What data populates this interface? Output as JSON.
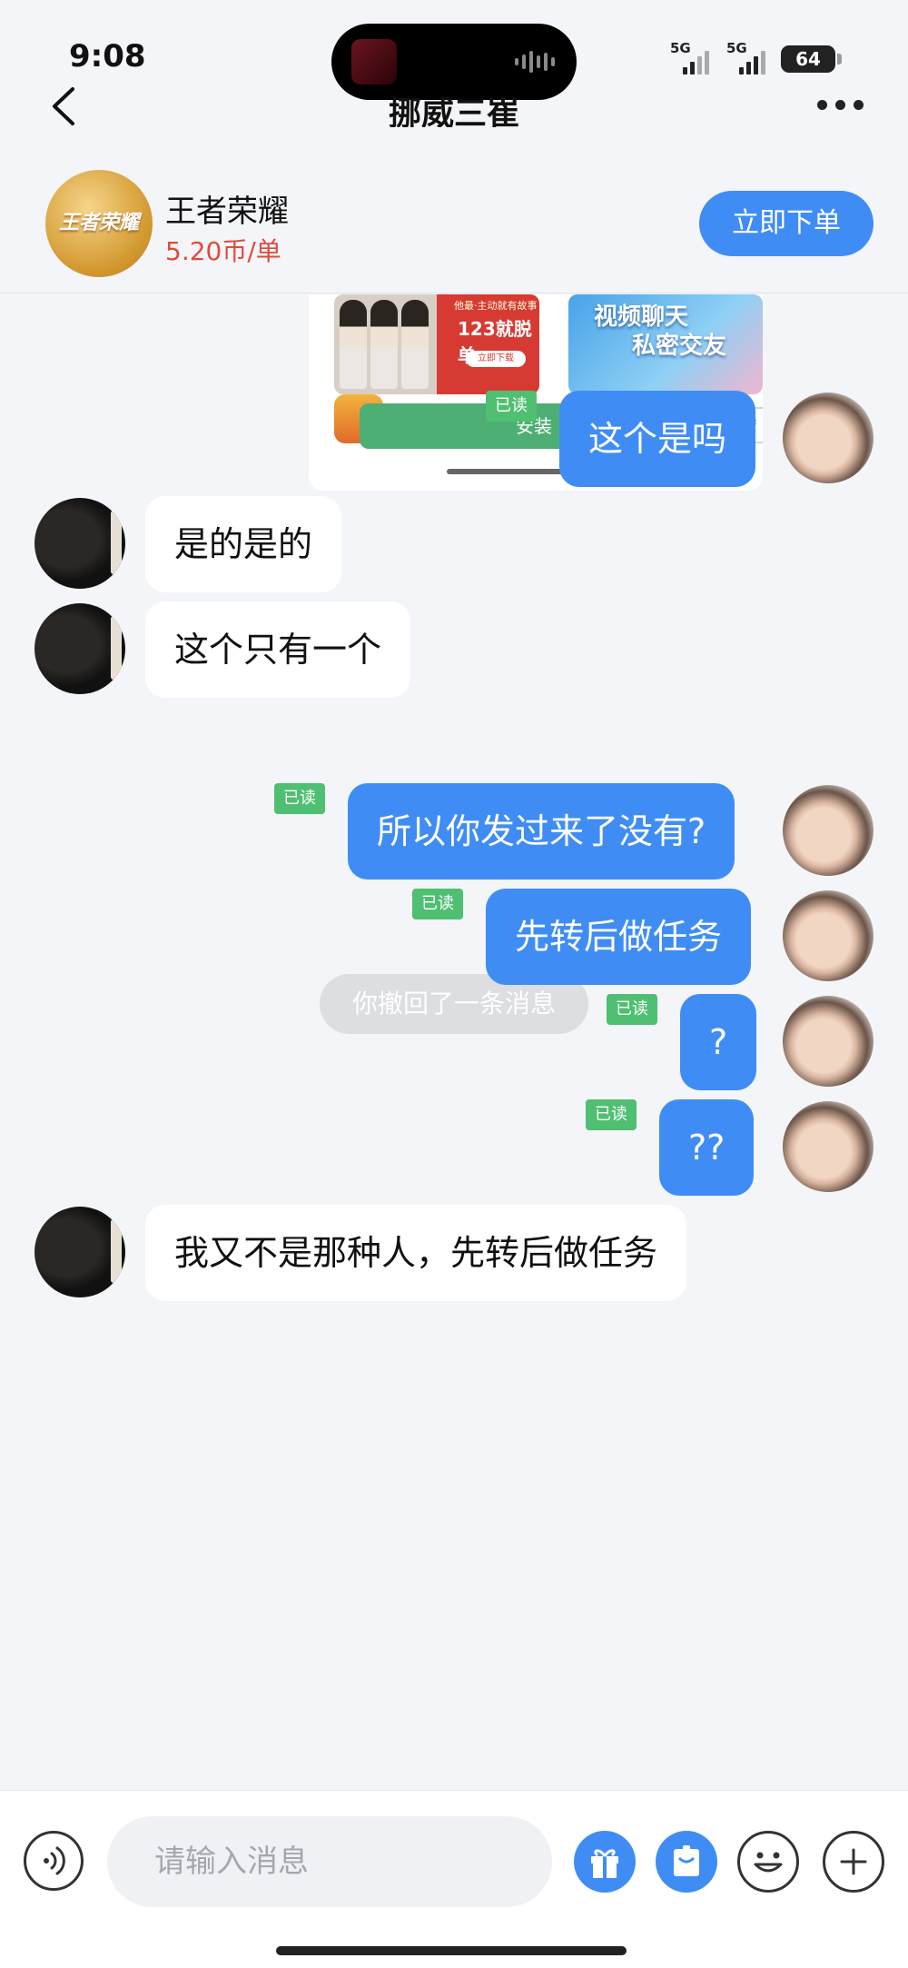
{
  "status": {
    "time": "9:08",
    "network_1": "5G",
    "network_2": "5G",
    "battery": "64"
  },
  "nav": {
    "title": "挪威三崔"
  },
  "service": {
    "name": "王者荣耀",
    "price": "5.20币/单",
    "order_button": "立即下单",
    "logo_text": "王者荣耀"
  },
  "ad": {
    "image1_caption": "他最·主动就有故事",
    "image1_title": "123就脱单",
    "image1_button": "立即下载",
    "image2_line1": "视频聊天",
    "image2_line2": "私密交友",
    "install_button": "安装",
    "install_button_2": "安"
  },
  "messages": [
    {
      "side": "me",
      "text": "这个是吗",
      "read": "已读"
    },
    {
      "side": "them",
      "text": "是的是的"
    },
    {
      "side": "them",
      "text": "这个只有一个"
    },
    {
      "side": "me",
      "text": "所以你发过来了没有?",
      "read": "已读"
    },
    {
      "side": "me",
      "text": "先转后做任务",
      "read": "已读"
    },
    {
      "side": "me",
      "text": "?",
      "read": "已读"
    },
    {
      "side": "me",
      "text": "??",
      "read": "已读"
    },
    {
      "side": "them",
      "text": "我又不是那种人，先转后做任务"
    }
  ],
  "system": {
    "recall_notice": "你撤回了一条消息"
  },
  "input": {
    "placeholder": "请输入消息"
  },
  "colors": {
    "accent": "#3f8df4",
    "price": "#e04b3c",
    "read_badge": "#4fbf72",
    "install": "#4eaf74"
  }
}
